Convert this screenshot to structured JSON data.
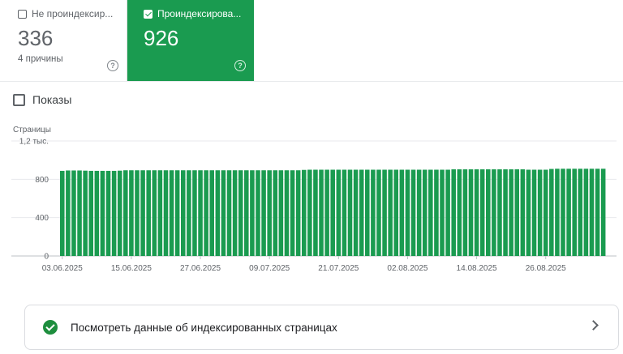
{
  "cards": {
    "not_indexed": {
      "label": "Не проиндексир...",
      "value": "336",
      "sub": "4 причины",
      "help": "?"
    },
    "indexed": {
      "label": "Проиндексирова...",
      "value": "926",
      "help": "?"
    }
  },
  "impressions_toggle": {
    "label": "Показы"
  },
  "link_card": {
    "label": "Посмотреть данные об индексированных страницах"
  },
  "colors": {
    "accent": "#1a9b50",
    "bar": "#1a9b50",
    "link_check": "#1e8e3e"
  },
  "icons": [
    "checkbox-icon",
    "help-icon",
    "check-circle-icon",
    "chevron-right-icon"
  ],
  "chart_data": {
    "type": "bar",
    "ylabel": "Страницы",
    "ylim": [
      0,
      1200
    ],
    "y_ticks": [
      {
        "value": 0,
        "label": "0"
      },
      {
        "value": 400,
        "label": "400"
      },
      {
        "value": 800,
        "label": "800"
      },
      {
        "value": 1200,
        "label": "1,2 тыс."
      }
    ],
    "x_start": "2025-06-03",
    "x_tick_labels": [
      "03.06.2025",
      "15.06.2025",
      "27.06.2025",
      "09.07.2025",
      "21.07.2025",
      "02.08.2025",
      "14.08.2025",
      "26.08.2025"
    ],
    "grid": true,
    "values": [
      888,
      892,
      892,
      892,
      890,
      888,
      888,
      888,
      888,
      888,
      890,
      894,
      894,
      894,
      894,
      894,
      894,
      894,
      894,
      894,
      894,
      894,
      894,
      894,
      894,
      894,
      894,
      894,
      894,
      894,
      894,
      894,
      894,
      894,
      894,
      894,
      894,
      894,
      894,
      894,
      894,
      894,
      898,
      900,
      900,
      900,
      900,
      900,
      900,
      900,
      900,
      900,
      900,
      900,
      900,
      900,
      900,
      900,
      900,
      900,
      900,
      900,
      900,
      900,
      900,
      900,
      900,
      900,
      904,
      904,
      904,
      904,
      904,
      904,
      904,
      904,
      904,
      904,
      904,
      904,
      904,
      900,
      900,
      900,
      900,
      908,
      910,
      910,
      910,
      910,
      910,
      910,
      910,
      910,
      910
    ]
  }
}
